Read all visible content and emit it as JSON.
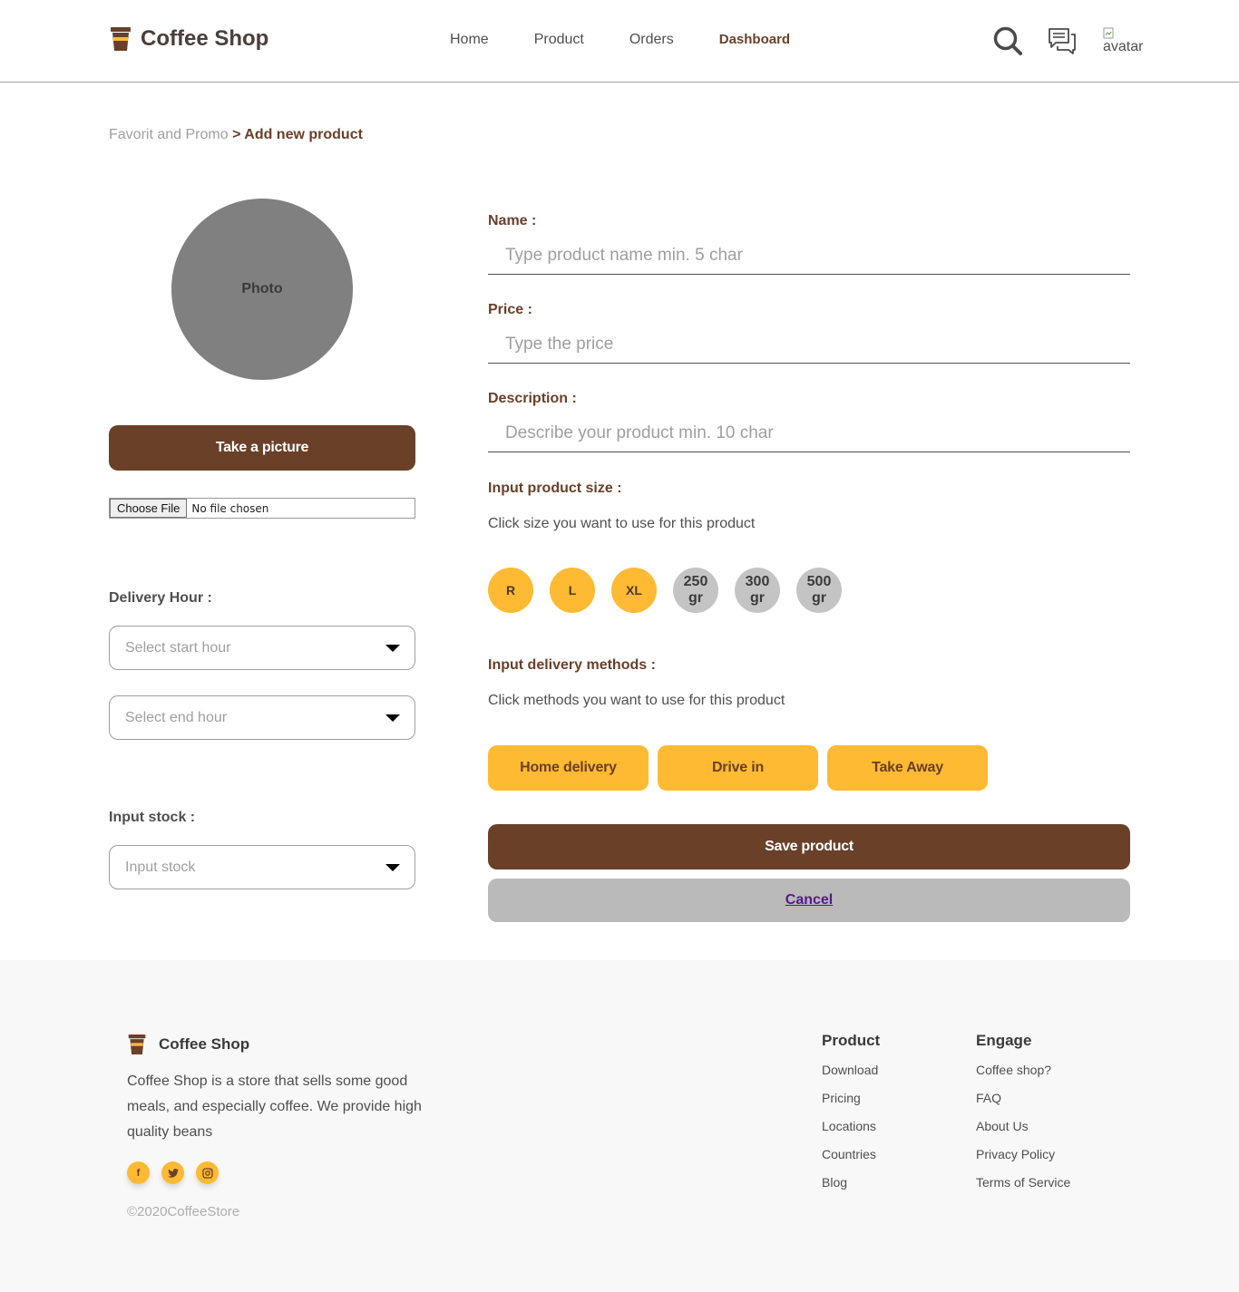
{
  "header": {
    "brand": "Coffee Shop",
    "nav": [
      "Home",
      "Product",
      "Orders",
      "Dashboard"
    ],
    "active_nav": "Dashboard",
    "avatar_alt": "avatar"
  },
  "breadcrumb": {
    "parent": "Favorit and Promo",
    "separator_current": "> Add new product"
  },
  "left": {
    "photo_label": "Photo",
    "take_picture": "Take a picture",
    "file_button": "Choose File",
    "file_status": "No file chosen",
    "delivery_hour_label": "Delivery Hour :",
    "start_hour_placeholder": "Select start hour",
    "end_hour_placeholder": "Select end hour",
    "stock_label": "Input stock :",
    "stock_placeholder": "Input stock"
  },
  "form": {
    "name_label": "Name :",
    "name_placeholder": "Type product name min. 5 char",
    "price_label": "Price :",
    "price_placeholder": "Type the price",
    "description_label": "Description :",
    "description_placeholder": "Describe your product min. 10 char",
    "size_label": "Input product size :",
    "size_helper": "Click size you want to use for this product",
    "sizes": [
      {
        "label": "R",
        "selected": true
      },
      {
        "label": "L",
        "selected": true
      },
      {
        "label": "XL",
        "selected": true
      },
      {
        "label": "250 gr",
        "selected": false
      },
      {
        "label": "300 gr",
        "selected": false
      },
      {
        "label": "500 gr",
        "selected": false
      }
    ],
    "delivery_label": "Input delivery methods :",
    "delivery_helper": "Click methods you want to use for this product",
    "methods": [
      "Home delivery",
      "Drive in",
      "Take Away"
    ],
    "save": "Save product",
    "cancel": "Cancel"
  },
  "footer": {
    "brand": "Coffee Shop",
    "description": "Coffee Shop is a store that sells some good meals, and especially coffee. We provide high quality beans",
    "socials": [
      "facebook-icon",
      "twitter-icon",
      "instagram-icon"
    ],
    "copyright": "©2020CoffeeStore",
    "product_title": "Product",
    "product_links": [
      "Download",
      "Pricing",
      "Locations",
      "Countries",
      "Blog"
    ],
    "engage_title": "Engage",
    "engage_links": [
      "Coffee shop?",
      "FAQ",
      "About Us",
      "Privacy Policy",
      "Terms of Service"
    ]
  },
  "colors": {
    "brown": "#6a4029",
    "yellow": "#ffba33",
    "grey_button": "#bababa",
    "photo_grey": "#808080",
    "size_off": "#c4c4c4",
    "footer_bg": "#f8f8f8"
  }
}
